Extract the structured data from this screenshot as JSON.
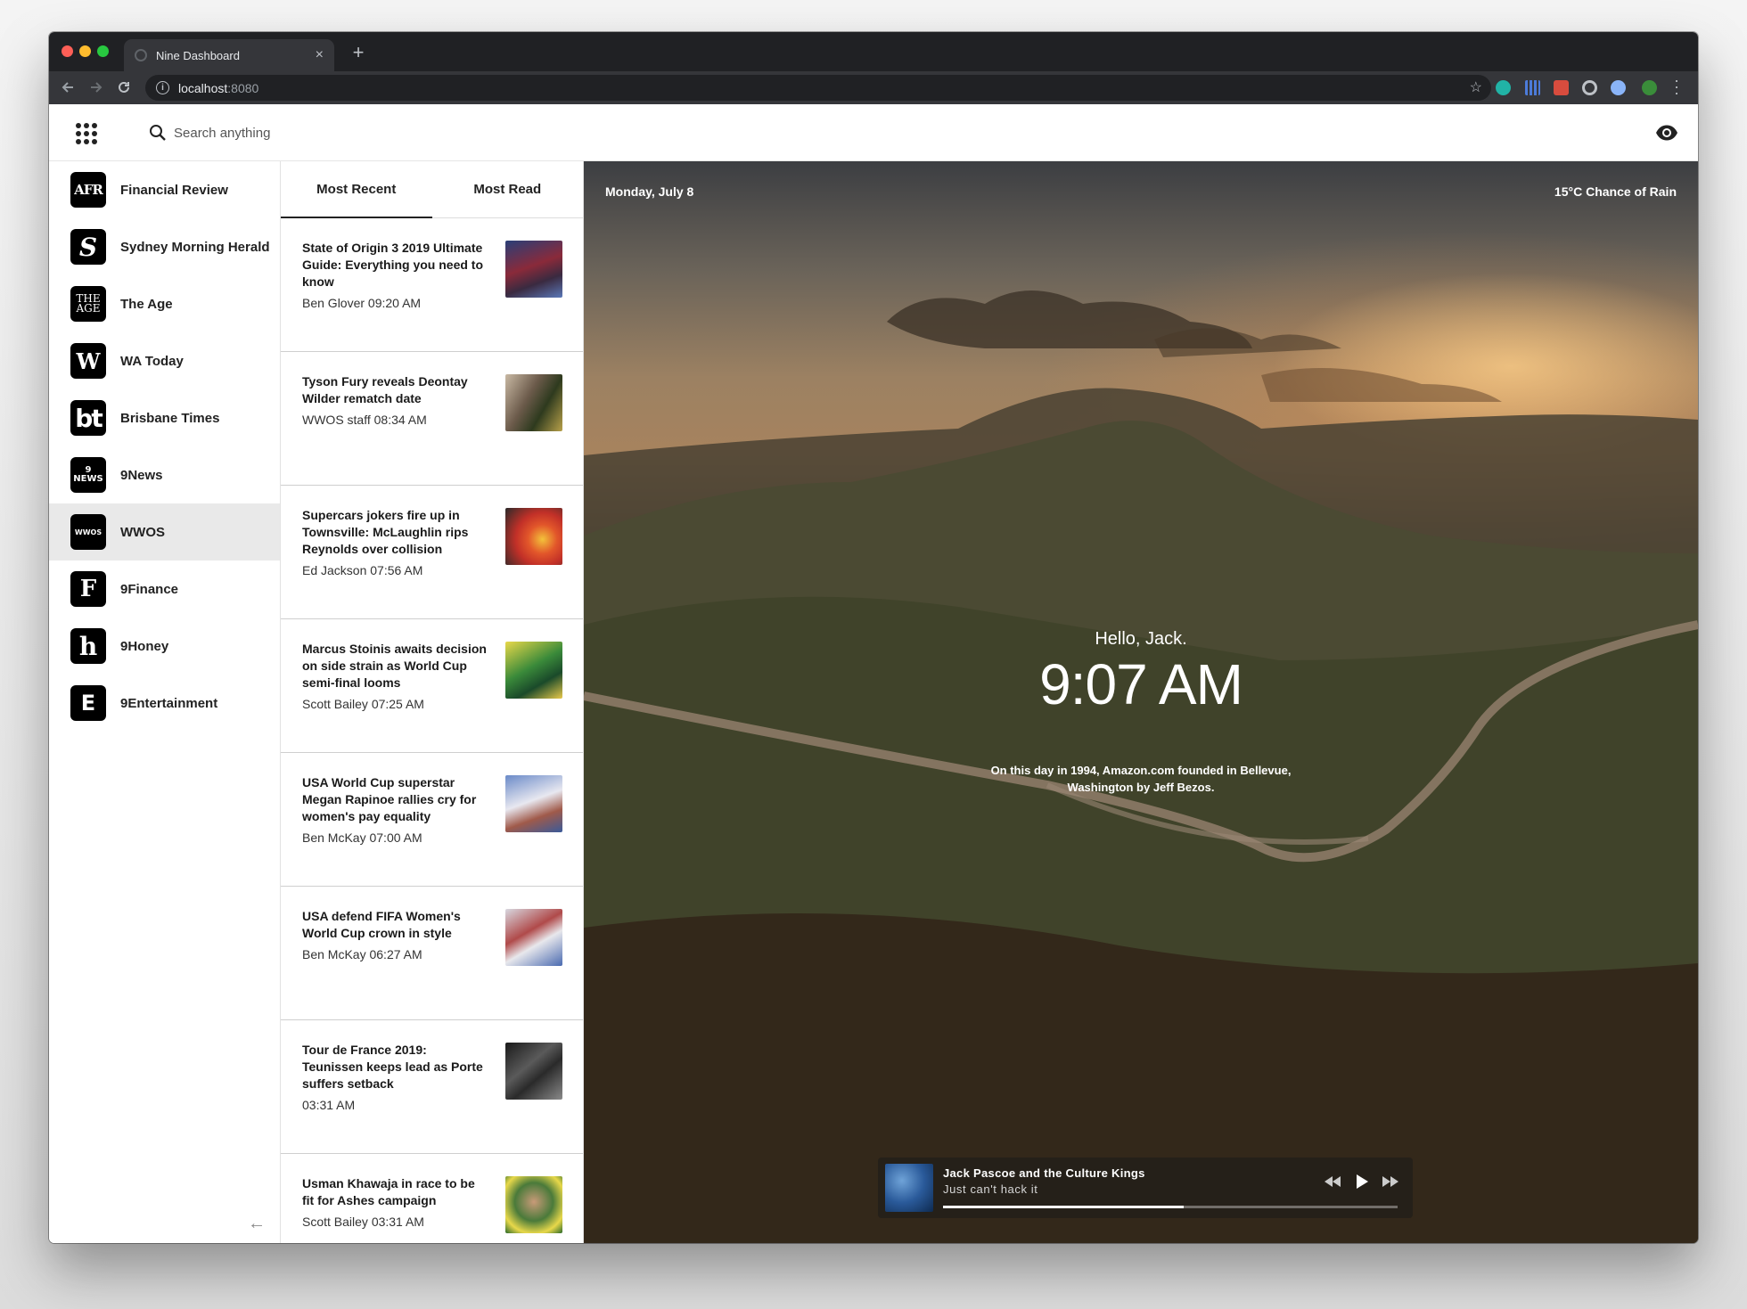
{
  "browser": {
    "tab_title": "Nine Dashboard",
    "tab_close": "×",
    "new_tab": "+",
    "url_host": "localhost",
    "url_port": ":8080",
    "icons": [
      "back-arrow-icon",
      "forward-arrow-icon",
      "reload-icon",
      "info-icon",
      "star-icon",
      "extension-icons",
      "menu-icon"
    ]
  },
  "header": {
    "search_placeholder": "Search anything",
    "icons": [
      "apps-grid-icon",
      "search-icon",
      "eye-icon"
    ]
  },
  "sidebar": {
    "publications": [
      {
        "name": "Financial Review",
        "logo": "AFR",
        "active": false
      },
      {
        "name": "Sydney Morning Herald",
        "logo": "S",
        "active": false
      },
      {
        "name": "The Age",
        "logo": "THE AGE",
        "active": false
      },
      {
        "name": "WA Today",
        "logo": "W",
        "active": false
      },
      {
        "name": "Brisbane Times",
        "logo": "bt",
        "active": false
      },
      {
        "name": "9News",
        "logo": "9 NEWS",
        "active": false
      },
      {
        "name": "WWOS",
        "logo": "WWOS",
        "active": true
      },
      {
        "name": "9Finance",
        "logo": "F",
        "active": false
      },
      {
        "name": "9Honey",
        "logo": "h",
        "active": false
      },
      {
        "name": "9Entertainment",
        "logo": "E",
        "active": false
      }
    ],
    "collapse_icon": "←"
  },
  "articles": {
    "tabs": [
      {
        "label": "Most Recent",
        "active": true
      },
      {
        "label": "Most Read",
        "active": false
      }
    ],
    "items": [
      {
        "title": "State of Origin 3 2019 Ultimate Guide: Everything you need to know",
        "author": "Ben Glover",
        "time": "09:20 AM",
        "meta": "Ben Glover  09:20 AM"
      },
      {
        "title": "Tyson Fury reveals Deontay Wilder rematch date",
        "author": "WWOS staff",
        "time": "08:34 AM",
        "meta": "WWOS staff  08:34 AM"
      },
      {
        "title": "Supercars jokers fire up in Townsville: McLaughlin rips Reynolds over collision",
        "author": "Ed Jackson",
        "time": "07:56 AM",
        "meta": "Ed Jackson  07:56 AM"
      },
      {
        "title": "Marcus Stoinis awaits decision on side strain as World Cup semi-final looms",
        "author": "Scott Bailey",
        "time": "07:25 AM",
        "meta": "Scott Bailey  07:25 AM"
      },
      {
        "title": "USA World Cup superstar Megan Rapinoe rallies cry for women's pay equality",
        "author": "Ben McKay",
        "time": "07:00 AM",
        "meta": "Ben McKay  07:00 AM"
      },
      {
        "title": "USA defend FIFA Women's World Cup crown in style",
        "author": "Ben McKay",
        "time": "06:27 AM",
        "meta": "Ben McKay  06:27 AM"
      },
      {
        "title": "Tour de France 2019: Teunissen keeps lead as Porte suffers setback",
        "author": "",
        "time": "03:31 AM",
        "meta": " 03:31 AM"
      },
      {
        "title": "Usman Khawaja in race to be fit for Ashes campaign",
        "author": "Scott Bailey",
        "time": "03:31 AM",
        "meta": "Scott Bailey  03:31 AM"
      }
    ]
  },
  "hero": {
    "date": "Monday, July 8",
    "weather": "15°C Chance of Rain",
    "greeting": "Hello, Jack.",
    "time": "9:07 AM",
    "fact": "On this day in 1994, Amazon.com founded in Bellevue, Washington by Jeff Bezos."
  },
  "player": {
    "artist": "Jack Pascoe and the Culture Kings",
    "song": "Just can't hack it",
    "progress_fraction": 0.53,
    "controls": [
      "rewind-icon",
      "play-icon",
      "fast-forward-icon"
    ]
  },
  "colors": {
    "browser_chrome": "#202124",
    "toolbar": "#35363a",
    "sidebar_active": "#e9e9e9",
    "accent_text": "#222222"
  }
}
